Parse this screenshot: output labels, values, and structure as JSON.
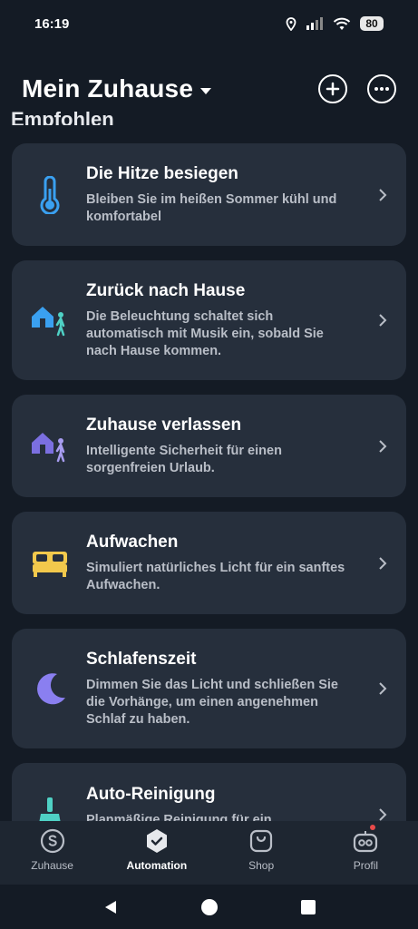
{
  "status": {
    "time": "16:19",
    "battery": "80"
  },
  "header": {
    "title": "Mein Zuhause",
    "section_peek": "Empfohlen"
  },
  "cards": [
    {
      "title": "Die Hitze besiegen",
      "desc_line1": "Bleiben Sie im heißen Sommer kühl und",
      "desc_line2": "komfortabel",
      "desc_line3": "",
      "icon": "thermometer-icon"
    },
    {
      "title": "Zurück nach Hause",
      "desc_line1": "Die Beleuchtung schaltet sich",
      "desc_line2": "automatisch mit Musik ein, sobald Sie",
      "desc_line3": "nach Hause kommen.",
      "icon": "home-arrive-icon"
    },
    {
      "title": "Zuhause verlassen",
      "desc_line1": "Intelligente Sicherheit für einen",
      "desc_line2": "sorgenfreien Urlaub.",
      "desc_line3": "",
      "icon": "home-leave-icon"
    },
    {
      "title": "Aufwachen",
      "desc_line1": "Simuliert natürliches Licht für ein sanftes",
      "desc_line2": "Aufwachen.",
      "desc_line3": "",
      "icon": "bed-icon"
    },
    {
      "title": "Schlafenszeit",
      "desc_line1": "Dimmen Sie das Licht und schließen Sie",
      "desc_line2": "die Vorhänge, um einen angenehmen",
      "desc_line3": "Schlaf zu haben.",
      "icon": "moon-icon"
    },
    {
      "title": "Auto-Reinigung",
      "desc_line1": "Planmäßige Reinigung für ein",
      "desc_line2": "",
      "desc_line3": "",
      "icon": "broom-icon"
    }
  ],
  "nav": {
    "home": "Zuhause",
    "automation": "Automation",
    "shop": "Shop",
    "profile": "Profil"
  },
  "colors": {
    "accent_blue": "#3aa0f0",
    "accent_purple": "#7b6fe0",
    "accent_yellow": "#f2c94c",
    "accent_teal": "#4fd1c5",
    "badge_red": "#e84a4a"
  }
}
